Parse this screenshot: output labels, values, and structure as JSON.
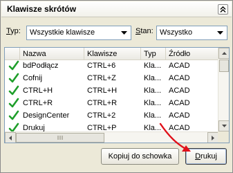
{
  "panel": {
    "title": "Klawisze skrótów"
  },
  "filters": {
    "type_label_accel": "T",
    "type_label_rest": "yp:",
    "type_value": "Wszystkie klawisze",
    "state_label_accel": "S",
    "state_label_rest": "tan:",
    "state_value": "Wszystko"
  },
  "grid": {
    "columns": [
      "Nazwa",
      "Klawisze",
      "Typ",
      "Źródło"
    ],
    "rows": [
      {
        "name": "bdPodłącz",
        "keys": "CTRL+6",
        "type": "Kla...",
        "source": "ACAD"
      },
      {
        "name": "Cofnij",
        "keys": "CTRL+Z",
        "type": "Kla...",
        "source": "ACAD"
      },
      {
        "name": "CTRL+H",
        "keys": "CTRL+H",
        "type": "Kla...",
        "source": "ACAD"
      },
      {
        "name": "CTRL+R",
        "keys": "CTRL+R",
        "type": "Kla...",
        "source": "ACAD"
      },
      {
        "name": "DesignCenter",
        "keys": "CTRL+2",
        "type": "Kla...",
        "source": "ACAD"
      },
      {
        "name": "Drukuj",
        "keys": "CTRL+P",
        "type": "Kla...",
        "source": "ACAD"
      }
    ]
  },
  "buttons": {
    "copy_label": "Kopiuj do schowka",
    "print_label_accel": "D",
    "print_label_rest": "rukuj"
  },
  "colors": {
    "check": "#1e9e2a",
    "annotation_arrow": "#e0101a"
  }
}
